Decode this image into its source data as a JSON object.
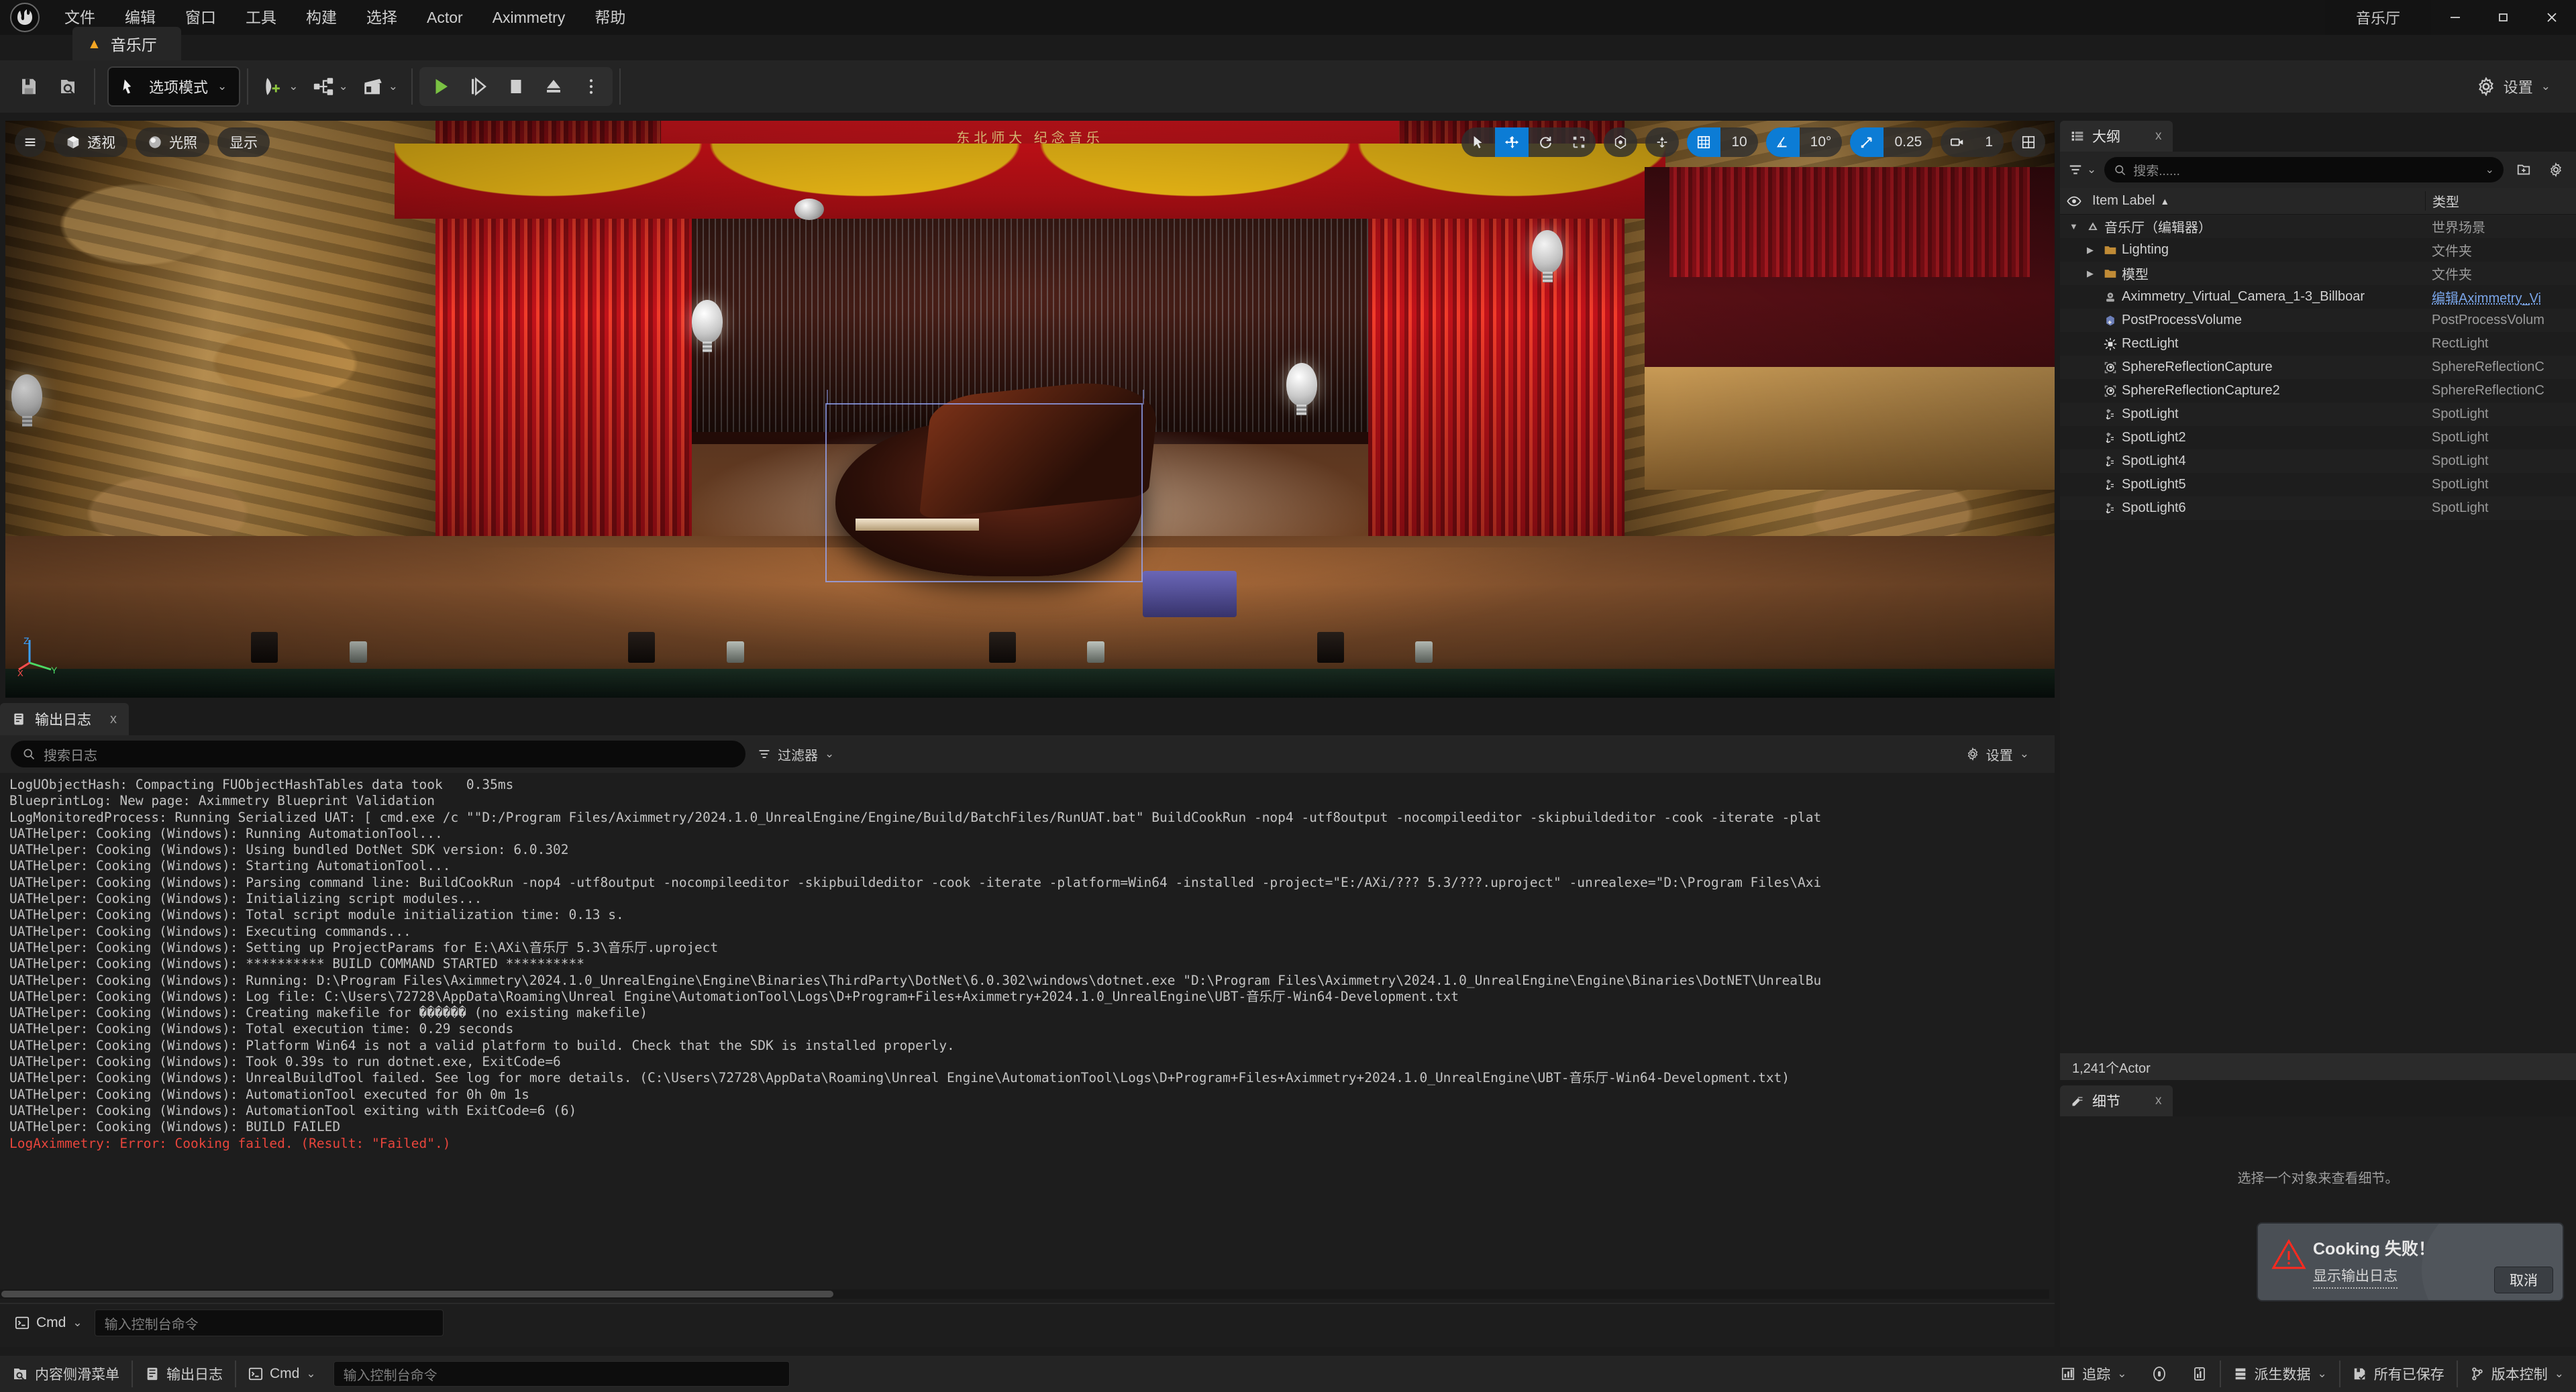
{
  "titlebar": {
    "menu": [
      "文件",
      "编辑",
      "窗口",
      "工具",
      "构建",
      "选择",
      "Actor",
      "Aximmetry",
      "帮助"
    ],
    "project_name": "音乐厅",
    "minimize": "—",
    "maximize": "❐",
    "close": "✕"
  },
  "level_tab": {
    "label": "音乐厅"
  },
  "toolbar": {
    "save_tooltip": "保存",
    "browse_tooltip": "浏览",
    "mode_label": "选项模式",
    "settings_label": "设置"
  },
  "viewport": {
    "menu_icon": "hamburger-icon",
    "perspective_label": "透视",
    "lit_label": "光照",
    "show_label": "显示",
    "grid_snap_value": "10",
    "angle_snap_value": "10°",
    "scale_snap_value": "0.25",
    "camera_speed_value": "1",
    "axis_z": "Z",
    "axis_y": "Y",
    "axis_x": "X",
    "banner_text": "东北师大 纪念音乐"
  },
  "output_log": {
    "tab_label": "输出日志",
    "close": "x",
    "search_placeholder": "搜索日志",
    "filter_label": "过滤器",
    "settings_label": "设置",
    "lines": [
      {
        "text": "LogUObjectHash: Compacting FUObjectHashTables data took   0.35ms",
        "error": false
      },
      {
        "text": "BlueprintLog: New page: Aximmetry Blueprint Validation",
        "error": false
      },
      {
        "text": "LogMonitoredProcess: Running Serialized UAT: [ cmd.exe /c \"\"D:/Program Files/Aximmetry/2024.1.0_UnrealEngine/Engine/Build/BatchFiles/RunUAT.bat\" BuildCookRun -nop4 -utf8output -nocompileeditor -skipbuildeditor -cook -iterate -plat",
        "error": false
      },
      {
        "text": "UATHelper: Cooking (Windows): Running AutomationTool...",
        "error": false
      },
      {
        "text": "UATHelper: Cooking (Windows): Using bundled DotNet SDK version: 6.0.302",
        "error": false
      },
      {
        "text": "UATHelper: Cooking (Windows): Starting AutomationTool...",
        "error": false
      },
      {
        "text": "UATHelper: Cooking (Windows): Parsing command line: BuildCookRun -nop4 -utf8output -nocompileeditor -skipbuildeditor -cook -iterate -platform=Win64 -installed -project=\"E:/AXi/??? 5.3/???.uproject\" -unrealexe=\"D:\\Program Files\\Axi",
        "error": false
      },
      {
        "text": "UATHelper: Cooking (Windows): Initializing script modules...",
        "error": false
      },
      {
        "text": "UATHelper: Cooking (Windows): Total script module initialization time: 0.13 s.",
        "error": false
      },
      {
        "text": "UATHelper: Cooking (Windows): Executing commands...",
        "error": false
      },
      {
        "text": "UATHelper: Cooking (Windows): Setting up ProjectParams for E:\\AXi\\音乐厅 5.3\\音乐厅.uproject",
        "error": false
      },
      {
        "text": "UATHelper: Cooking (Windows): ********** BUILD COMMAND STARTED **********",
        "error": false
      },
      {
        "text": "UATHelper: Cooking (Windows): Running: D:\\Program Files\\Aximmetry\\2024.1.0_UnrealEngine\\Engine\\Binaries\\ThirdParty\\DotNet\\6.0.302\\windows\\dotnet.exe \"D:\\Program Files\\Aximmetry\\2024.1.0_UnrealEngine\\Engine\\Binaries\\DotNET\\UnrealBu",
        "error": false
      },
      {
        "text": "UATHelper: Cooking (Windows): Log file: C:\\Users\\72728\\AppData\\Roaming\\Unreal Engine\\AutomationTool\\Logs\\D+Program+Files+Aximmetry+2024.1.0_UnrealEngine\\UBT-音乐厅-Win64-Development.txt",
        "error": false
      },
      {
        "text": "UATHelper: Cooking (Windows): Creating makefile for ������ (no existing makefile)",
        "error": false
      },
      {
        "text": "UATHelper: Cooking (Windows): Total execution time: 0.29 seconds",
        "error": false
      },
      {
        "text": "UATHelper: Cooking (Windows): Platform Win64 is not a valid platform to build. Check that the SDK is installed properly.",
        "error": false
      },
      {
        "text": "UATHelper: Cooking (Windows): Took 0.39s to run dotnet.exe, ExitCode=6",
        "error": false
      },
      {
        "text": "UATHelper: Cooking (Windows): UnrealBuildTool failed. See log for more details. (C:\\Users\\72728\\AppData\\Roaming\\Unreal Engine\\AutomationTool\\Logs\\D+Program+Files+Aximmetry+2024.1.0_UnrealEngine\\UBT-音乐厅-Win64-Development.txt)",
        "error": false
      },
      {
        "text": "UATHelper: Cooking (Windows): AutomationTool executed for 0h 0m 1s",
        "error": false
      },
      {
        "text": "UATHelper: Cooking (Windows): AutomationTool exiting with ExitCode=6 (6)",
        "error": false
      },
      {
        "text": "UATHelper: Cooking (Windows): BUILD FAILED",
        "error": false
      },
      {
        "text": "LogAximmetry: Error: Cooking failed. (Result: \"Failed\".)",
        "error": true
      }
    ],
    "cmd_label": "Cmd",
    "cmd_placeholder": "输入控制台命令"
  },
  "outliner": {
    "tab_label": "大纲",
    "close": "x",
    "search_placeholder": "搜索......",
    "col_item_label": "Item Label",
    "col_type": "类型",
    "sort_arrow": "▲",
    "rows": [
      {
        "label": "音乐厅（编辑器）",
        "type": "世界场景",
        "indent": 0,
        "expander": "▼",
        "icon": "world-icon",
        "link": false
      },
      {
        "label": "Lighting",
        "type": "文件夹",
        "indent": 1,
        "expander": "▶",
        "icon": "folder-icon",
        "link": false
      },
      {
        "label": "模型",
        "type": "文件夹",
        "indent": 1,
        "expander": "▶",
        "icon": "folder-icon",
        "link": false
      },
      {
        "label": "Aximmetry_Virtual_Camera_1-3_Billboar",
        "type": "编辑Aximmetry_Vi",
        "indent": 1,
        "expander": "",
        "icon": "camera-icon",
        "link": true
      },
      {
        "label": "PostProcessVolume",
        "type": "PostProcessVolum",
        "indent": 1,
        "expander": "",
        "icon": "volume-icon",
        "link": false
      },
      {
        "label": "RectLight",
        "type": "RectLight",
        "indent": 1,
        "expander": "",
        "icon": "rectlight-icon",
        "link": false
      },
      {
        "label": "SphereReflectionCapture",
        "type": "SphereReflectionC",
        "indent": 1,
        "expander": "",
        "icon": "reflection-icon",
        "link": false
      },
      {
        "label": "SphereReflectionCapture2",
        "type": "SphereReflectionC",
        "indent": 1,
        "expander": "",
        "icon": "reflection-icon",
        "link": false
      },
      {
        "label": "SpotLight",
        "type": "SpotLight",
        "indent": 1,
        "expander": "",
        "icon": "spotlight-icon",
        "link": false
      },
      {
        "label": "SpotLight2",
        "type": "SpotLight",
        "indent": 1,
        "expander": "",
        "icon": "spotlight-icon",
        "link": false
      },
      {
        "label": "SpotLight4",
        "type": "SpotLight",
        "indent": 1,
        "expander": "",
        "icon": "spotlight-icon",
        "link": false
      },
      {
        "label": "SpotLight5",
        "type": "SpotLight",
        "indent": 1,
        "expander": "",
        "icon": "spotlight-icon",
        "link": false
      },
      {
        "label": "SpotLight6",
        "type": "SpotLight",
        "indent": 1,
        "expander": "",
        "icon": "spotlight-icon",
        "link": false
      }
    ],
    "actor_count": "1,241个Actor"
  },
  "details": {
    "tab_label": "细节",
    "close": "x",
    "empty_text": "选择一个对象来查看细节。"
  },
  "toast": {
    "title": "Cooking 失败！",
    "link": "显示输出日志",
    "button": "取消"
  },
  "statusbar": {
    "content_drawer": "内容侧滑菜单",
    "output_log": "输出日志",
    "cmd_label": "Cmd",
    "cmd_placeholder": "输入控制台命令",
    "trace": "追踪",
    "derived_data": "派生数据",
    "all_saved": "所有已保存",
    "source_control": "版本控制"
  },
  "colors": {
    "accent_blue": "#0c7cd5",
    "error_red": "#e8453c",
    "play_green": "#7ac143",
    "link_blue": "#7aa5e8",
    "panel_bg": "#1d1d1d",
    "toolbar_bg": "#242424"
  }
}
